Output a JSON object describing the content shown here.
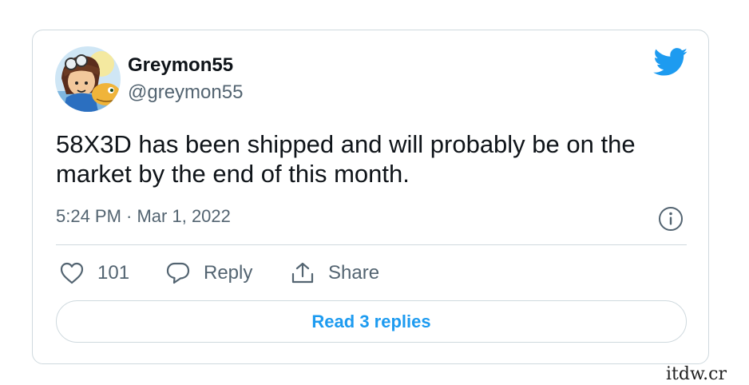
{
  "tweet": {
    "author": {
      "display_name": "Greymon55",
      "handle": "@greymon55",
      "avatar_icon": "avatar-image"
    },
    "brand_icon": "twitter-bird-icon",
    "brand_color": "#1d9bf0",
    "text": "58X3D has been shipped and will probably be on the market by the end of this month.",
    "timestamp": "5:24 PM · Mar 1, 2022",
    "info_icon": "info-icon",
    "actions": {
      "like": {
        "icon": "heart-icon",
        "count": "101"
      },
      "reply": {
        "icon": "speech-bubble-icon",
        "label": "Reply"
      },
      "share": {
        "icon": "share-arrow-icon",
        "label": "Share"
      }
    },
    "read_replies_label": "Read 3 replies"
  },
  "watermark": "itdw.cr"
}
